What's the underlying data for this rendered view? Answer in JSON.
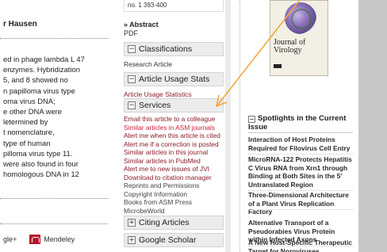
{
  "left": {
    "author": "r Hausen",
    "abstract_lines": [
      "ed in phage lambda L 47",
      " enzymes. Hybridization",
      "5, and 8 showed no",
      "n papilloma virus type",
      "oma virus DNA;",
      "e other DNA were",
      "letermined by",
      "t nomenclature,",
      "type of human",
      "pilloma virus type 11.",
      " were also found in four",
      " homologous DNA in 12"
    ],
    "social_google": "gle+",
    "social_mendeley": "Mendeley"
  },
  "middle": {
    "pages": "no. 1 393-400",
    "abstract_label": "» Abstract",
    "pdf_label": "PDF",
    "classifications": {
      "title": "Classifications",
      "toggle": "−",
      "items": [
        "Research Article"
      ]
    },
    "usage": {
      "title": "Article Usage Stats",
      "toggle": "−",
      "items": [
        "Article Usage Statistics"
      ]
    },
    "services": {
      "title": "Services",
      "toggle": "−",
      "items": [
        "Email this article to a colleague",
        "Similar articles in ASM journals",
        "Alert me when this article is cited",
        "Alert me if a correction is posted",
        "Similar articles in this journal",
        "Similar articles in PubMed",
        "Alert me to new issues of JVI",
        "Download to citation manager",
        "Reprints and Permissions",
        "Copyright Information",
        "Books from ASM Press",
        "MicrobeWorld"
      ]
    },
    "citing": {
      "title": "Citing Articles",
      "toggle": "+"
    },
    "scholar": {
      "title": "Google Scholar",
      "toggle": "+"
    }
  },
  "right": {
    "cover_title": "Journal of Virology",
    "spotlights_toggle": "−",
    "spotlights_title": "Spotlights in the Current Issue",
    "spotlights": [
      "Interaction of Host Proteins Required for Filovirus Cell Entry",
      "MicroRNA-122 Protects Hepatitis C Virus RNA from Xrn1 through Binding at Both Sites in the 5′ Untranslated Region",
      "Three-Dimensional Architecture of a Plant Virus Replication Factory",
      "Alternative Transport of a Pseudorabies Virus Protein within Infected Axons",
      "A New Host-Specific Therapeutic Target for Noroviruses"
    ]
  },
  "colors": {
    "link": "#8b1c2b",
    "highlight_link": "#d0203a",
    "arrow": "#f4a73b",
    "section_bg": "#ececec"
  }
}
